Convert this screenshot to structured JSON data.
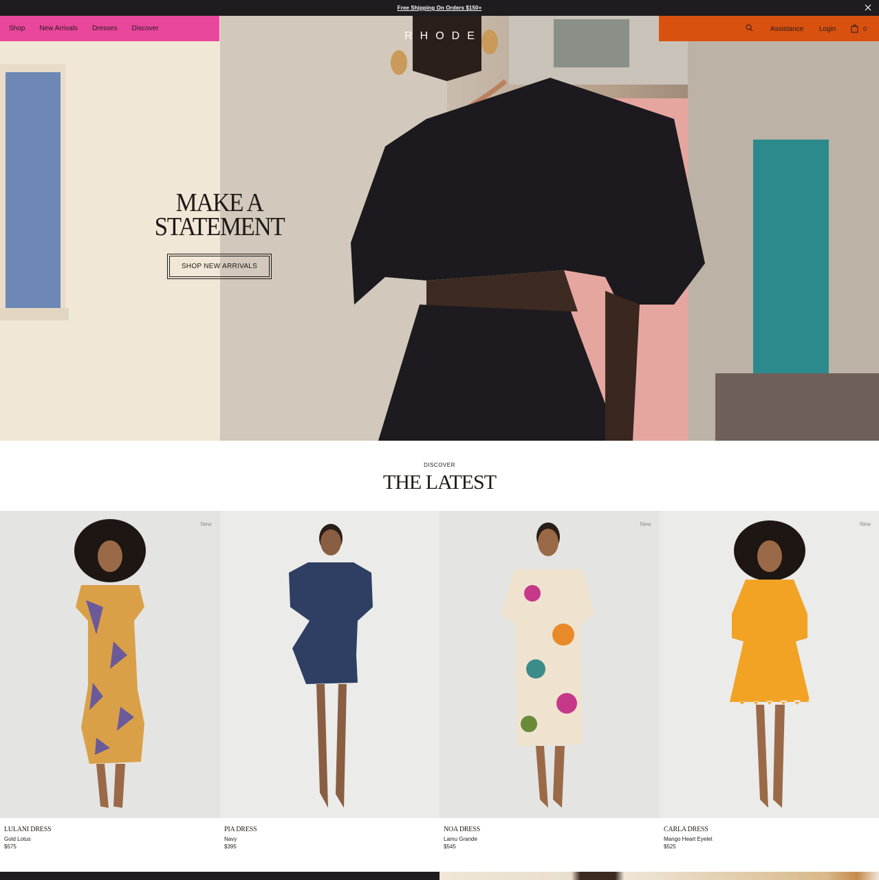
{
  "announcement": {
    "text": "Free Shipping On Orders $150+"
  },
  "header": {
    "nav_left": [
      "Shop",
      "New Arrivals",
      "Dresses",
      "Discover"
    ],
    "logo": "RHODE",
    "assistance": "Assistance",
    "login": "Login",
    "cart_count": "0",
    "colors": {
      "left_panel": "#e9479b",
      "right_panel": "#d9510f"
    },
    "icons": [
      "search-icon",
      "bag-icon",
      "close-icon"
    ]
  },
  "hero": {
    "title_line1": "MAKE A",
    "title_line2": "STATEMENT",
    "cta": "SHOP NEW ARRIVALS"
  },
  "latest": {
    "eyebrow": "DISCOVER",
    "title": "THE LATEST",
    "products": [
      {
        "name": "LULANI DRESS",
        "color": "Gold Lotus",
        "price": "$575",
        "badge": "New"
      },
      {
        "name": "PIA DRESS",
        "color": "Navy",
        "price": "$395",
        "badge": ""
      },
      {
        "name": "NOA DRESS",
        "color": "Lamu Grande",
        "price": "$545",
        "badge": "New"
      },
      {
        "name": "CARLA DRESS",
        "color": "Mango Heart Eyelet",
        "price": "$525",
        "badge": "New"
      }
    ]
  }
}
